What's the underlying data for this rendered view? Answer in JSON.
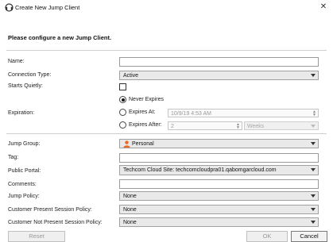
{
  "window": {
    "title": "Create New Jump Client"
  },
  "heading": "Please configure a new Jump Client.",
  "fields": {
    "name": {
      "label": "Name:",
      "value": ""
    },
    "connection_type": {
      "label": "Connection Type:",
      "value": "Active"
    },
    "starts_quietly": {
      "label": "Starts Quietly:",
      "checked": false
    },
    "expiration": {
      "label": "Expiration:",
      "never_expires": "Never Expires",
      "expires_at": "Expires  At:",
      "expires_at_value": "10/9/19 4:53 AM",
      "expires_after": "Expires After:",
      "expires_after_value": "2",
      "expires_after_unit": "Weeks",
      "selected": "never_expires"
    },
    "jump_group": {
      "label": "Jump Group:",
      "value": "Personal"
    },
    "tag": {
      "label": "Tag:",
      "value": ""
    },
    "public_portal": {
      "label": "Public Portal:",
      "value": "Techcom Cloud Site: techcomcloudpra01.qabomgarcloud.com"
    },
    "comments": {
      "label": "Comments:",
      "value": ""
    },
    "jump_policy": {
      "label": "Jump Policy:",
      "value": "None"
    },
    "customer_present": {
      "label": "Customer Present Session Policy:",
      "value": "None"
    },
    "customer_not_present": {
      "label": "Customer Not Present Session Policy:",
      "value": "None"
    }
  },
  "buttons": {
    "reset": "Reset",
    "ok": "OK",
    "cancel": "Cancel"
  },
  "colors": {
    "person_icon": "#e8692a",
    "accent_border": "#7a7a7a"
  }
}
